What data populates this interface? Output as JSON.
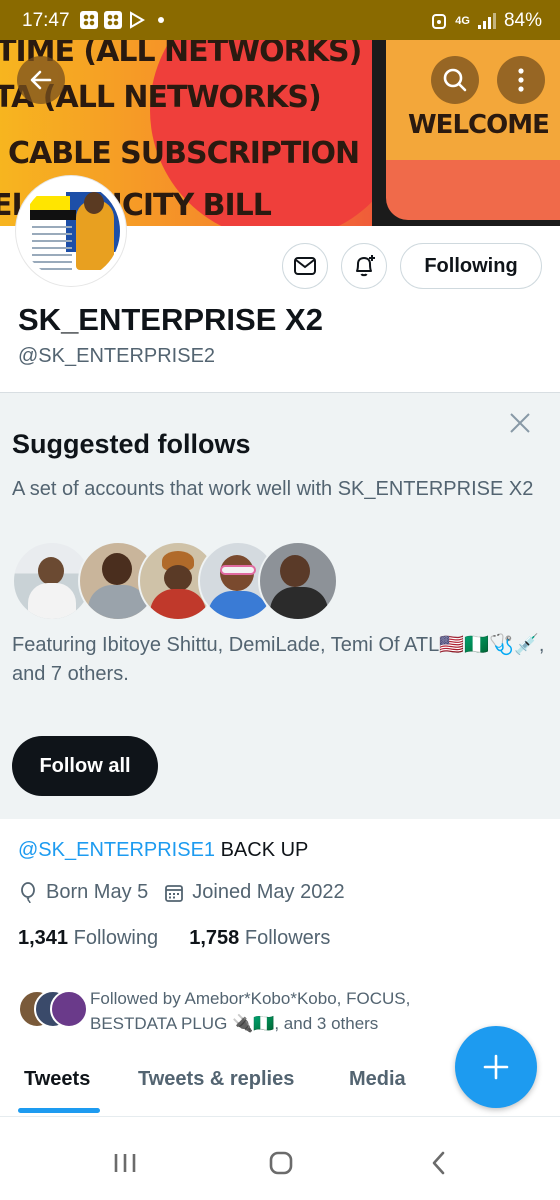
{
  "status_bar": {
    "time": "17:47",
    "battery": "84%",
    "network": "4G"
  },
  "banner": {
    "lines": [
      "TIME (ALL NETWORKS)",
      "TA (ALL NETWORKS)",
      "CABLE SUBSCRIPTION",
      "ELECTRICITY BILL"
    ],
    "welcome": "WELCOME"
  },
  "profile": {
    "name": "SK_ENTERPRISE X2",
    "handle": "@SK_ENTERPRISE2",
    "following_button": "Following"
  },
  "suggested": {
    "title": "Suggested follows",
    "description": "A set of accounts that work well with SK_ENTERPRISE X2",
    "featuring": "Featuring Ibitoye Shittu, DemiLade, Temi Of ATL🇺🇸🇳🇬🩺💉, and 7 others.",
    "follow_all": "Follow all"
  },
  "bio": {
    "mention": "@SK_ENTERPRISE1",
    "text": " BACK UP"
  },
  "meta": {
    "born": "Born May 5",
    "joined": "Joined May 2022"
  },
  "stats": {
    "following_count": "1,341",
    "following_label": "Following",
    "followers_count": "1,758",
    "followers_label": "Followers"
  },
  "followed_by": "Followed by Amebor*Kobo*Kobo, FOCUS, BESTDATA PLUG 🔌🇳🇬, and 3 others",
  "tabs": [
    "Tweets",
    "Tweets & replies",
    "Media"
  ],
  "colors": {
    "accent": "#1d9bf0",
    "text": "#0f1419",
    "muted": "#536471",
    "status_bar": "#8a6a00"
  }
}
